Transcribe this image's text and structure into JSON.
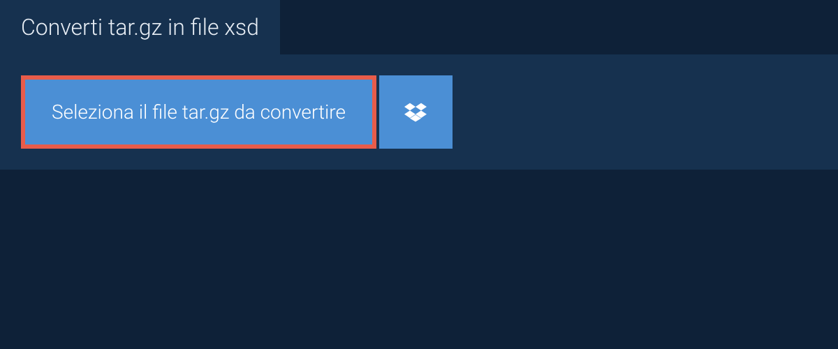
{
  "tab": {
    "title": "Converti tar.gz in file xsd"
  },
  "actions": {
    "select_file_label": "Seleziona il file tar.gz da convertire"
  }
}
